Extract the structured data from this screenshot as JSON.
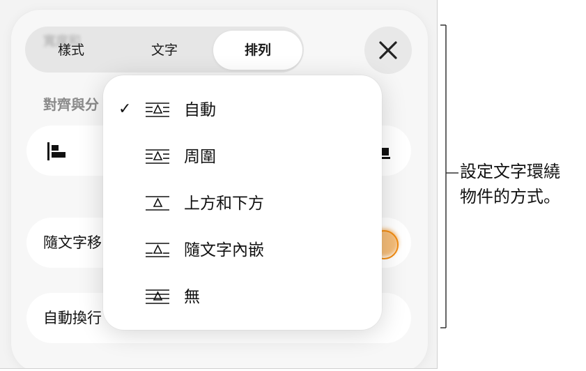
{
  "segment": {
    "ghost_title": "寬度和",
    "tabs": [
      {
        "label": "樣式"
      },
      {
        "label": "文字"
      },
      {
        "label": "排列"
      }
    ]
  },
  "section_title": "對齊與分",
  "rows": {
    "inline_label": "隨文字移",
    "wrap_label": "自動換行"
  },
  "menu": {
    "items": [
      {
        "label": "自動",
        "checked": true,
        "icon": "wrap-auto-icon"
      },
      {
        "label": "周圍",
        "checked": false,
        "icon": "wrap-around-icon"
      },
      {
        "label": "上方和下方",
        "checked": false,
        "icon": "wrap-above-below-icon"
      },
      {
        "label": "隨文字內嵌",
        "checked": false,
        "icon": "wrap-inline-icon"
      },
      {
        "label": "無",
        "checked": false,
        "icon": "wrap-none-icon"
      }
    ],
    "check_glyph": "✓"
  },
  "callout": {
    "line1": "設定文字環繞",
    "line2": "物件的方式。"
  },
  "colors": {
    "toggle_accent": "#f08a10",
    "panel_bg": "#f7f7f7"
  }
}
